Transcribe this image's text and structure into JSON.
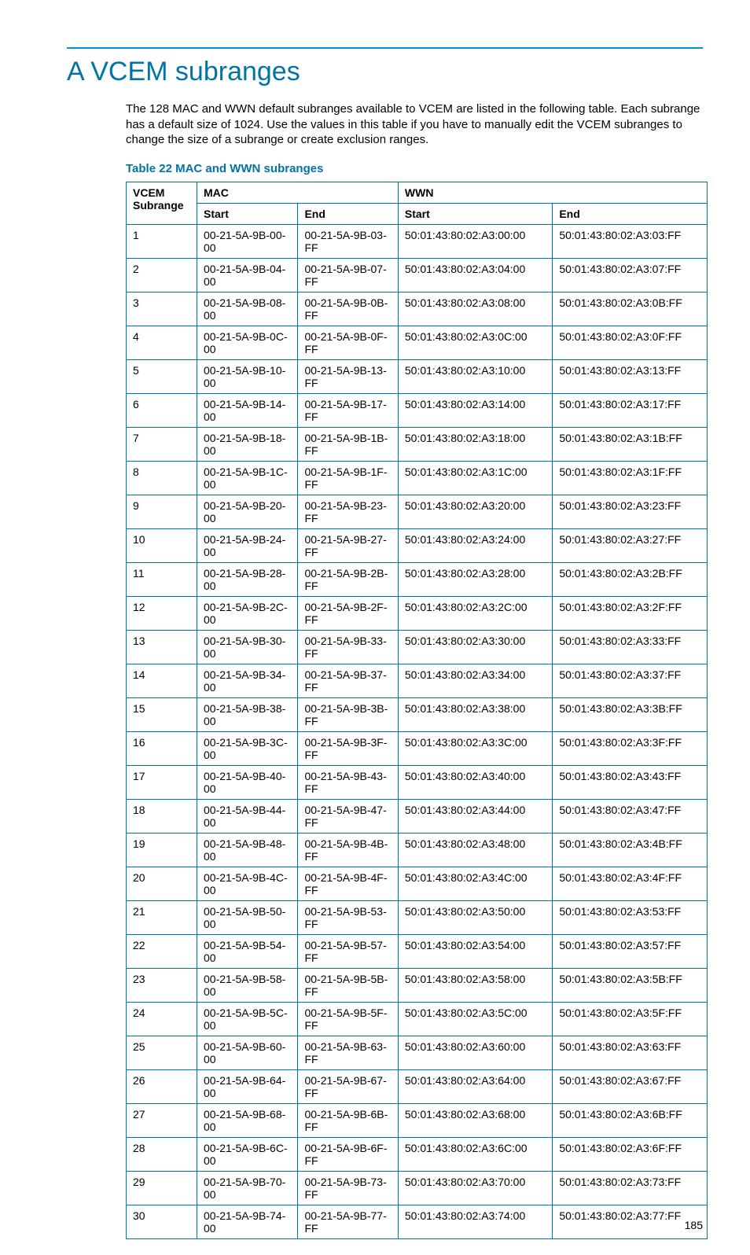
{
  "heading": "A VCEM subranges",
  "intro": "The 128 MAC and WWN default subranges available to VCEM are listed in the following table. Each subrange has a default size of 1024. Use the values in this table if you have to manually edit the VCEM subranges to change the size of a subrange or create exclusion ranges.",
  "table_caption": "Table 22 MAC and WWN subranges",
  "headers": {
    "subrange": "VCEM Subrange",
    "mac": "MAC",
    "wwn": "WWN",
    "start": "Start",
    "end": "End"
  },
  "rows": [
    {
      "n": "1",
      "ms": "00-21-5A-9B-00-00",
      "me": "00-21-5A-9B-03-FF",
      "ws": "50:01:43:80:02:A3:00:00",
      "we": "50:01:43:80:02:A3:03:FF"
    },
    {
      "n": "2",
      "ms": "00-21-5A-9B-04-00",
      "me": "00-21-5A-9B-07-FF",
      "ws": "50:01:43:80:02:A3:04:00",
      "we": "50:01:43:80:02:A3:07:FF"
    },
    {
      "n": "3",
      "ms": "00-21-5A-9B-08-00",
      "me": "00-21-5A-9B-0B-FF",
      "ws": "50:01:43:80:02:A3:08:00",
      "we": "50:01:43:80:02:A3:0B:FF"
    },
    {
      "n": "4",
      "ms": "00-21-5A-9B-0C-00",
      "me": "00-21-5A-9B-0F-FF",
      "ws": "50:01:43:80:02:A3:0C:00",
      "we": "50:01:43:80:02:A3:0F:FF"
    },
    {
      "n": "5",
      "ms": "00-21-5A-9B-10-00",
      "me": "00-21-5A-9B-13-FF",
      "ws": "50:01:43:80:02:A3:10:00",
      "we": "50:01:43:80:02:A3:13:FF"
    },
    {
      "n": "6",
      "ms": "00-21-5A-9B-14-00",
      "me": "00-21-5A-9B-17-FF",
      "ws": "50:01:43:80:02:A3:14:00",
      "we": "50:01:43:80:02:A3:17:FF"
    },
    {
      "n": "7",
      "ms": "00-21-5A-9B-18-00",
      "me": "00-21-5A-9B-1B-FF",
      "ws": "50:01:43:80:02:A3:18:00",
      "we": "50:01:43:80:02:A3:1B:FF"
    },
    {
      "n": "8",
      "ms": "00-21-5A-9B-1C-00",
      "me": "00-21-5A-9B-1F-FF",
      "ws": "50:01:43:80:02:A3:1C:00",
      "we": "50:01:43:80:02:A3:1F:FF"
    },
    {
      "n": "9",
      "ms": "00-21-5A-9B-20-00",
      "me": "00-21-5A-9B-23-FF",
      "ws": "50:01:43:80:02:A3:20:00",
      "we": "50:01:43:80:02:A3:23:FF"
    },
    {
      "n": "10",
      "ms": "00-21-5A-9B-24-00",
      "me": "00-21-5A-9B-27-FF",
      "ws": "50:01:43:80:02:A3:24:00",
      "we": "50:01:43:80:02:A3:27:FF"
    },
    {
      "n": "11",
      "ms": "00-21-5A-9B-28-00",
      "me": "00-21-5A-9B-2B-FF",
      "ws": "50:01:43:80:02:A3:28:00",
      "we": "50:01:43:80:02:A3:2B:FF"
    },
    {
      "n": "12",
      "ms": "00-21-5A-9B-2C-00",
      "me": "00-21-5A-9B-2F-FF",
      "ws": "50:01:43:80:02:A3:2C:00",
      "we": "50:01:43:80:02:A3:2F:FF"
    },
    {
      "n": "13",
      "ms": "00-21-5A-9B-30-00",
      "me": "00-21-5A-9B-33-FF",
      "ws": "50:01:43:80:02:A3:30:00",
      "we": "50:01:43:80:02:A3:33:FF"
    },
    {
      "n": "14",
      "ms": "00-21-5A-9B-34-00",
      "me": "00-21-5A-9B-37-FF",
      "ws": "50:01:43:80:02:A3:34:00",
      "we": "50:01:43:80:02:A3:37:FF"
    },
    {
      "n": "15",
      "ms": "00-21-5A-9B-38-00",
      "me": "00-21-5A-9B-3B-FF",
      "ws": "50:01:43:80:02:A3:38:00",
      "we": "50:01:43:80:02:A3:3B:FF"
    },
    {
      "n": "16",
      "ms": "00-21-5A-9B-3C-00",
      "me": "00-21-5A-9B-3F-FF",
      "ws": "50:01:43:80:02:A3:3C:00",
      "we": "50:01:43:80:02:A3:3F:FF"
    },
    {
      "n": "17",
      "ms": "00-21-5A-9B-40-00",
      "me": "00-21-5A-9B-43-FF",
      "ws": "50:01:43:80:02:A3:40:00",
      "we": "50:01:43:80:02:A3:43:FF"
    },
    {
      "n": "18",
      "ms": "00-21-5A-9B-44-00",
      "me": "00-21-5A-9B-47-FF",
      "ws": "50:01:43:80:02:A3:44:00",
      "we": "50:01:43:80:02:A3:47:FF"
    },
    {
      "n": "19",
      "ms": "00-21-5A-9B-48-00",
      "me": "00-21-5A-9B-4B-FF",
      "ws": "50:01:43:80:02:A3:48:00",
      "we": "50:01:43:80:02:A3:4B:FF"
    },
    {
      "n": "20",
      "ms": "00-21-5A-9B-4C-00",
      "me": "00-21-5A-9B-4F-FF",
      "ws": "50:01:43:80:02:A3:4C:00",
      "we": "50:01:43:80:02:A3:4F:FF"
    },
    {
      "n": "21",
      "ms": "00-21-5A-9B-50-00",
      "me": "00-21-5A-9B-53-FF",
      "ws": "50:01:43:80:02:A3:50:00",
      "we": "50:01:43:80:02:A3:53:FF"
    },
    {
      "n": "22",
      "ms": "00-21-5A-9B-54-00",
      "me": "00-21-5A-9B-57-FF",
      "ws": "50:01:43:80:02:A3:54:00",
      "we": "50:01:43:80:02:A3:57:FF"
    },
    {
      "n": "23",
      "ms": "00-21-5A-9B-58-00",
      "me": "00-21-5A-9B-5B-FF",
      "ws": "50:01:43:80:02:A3:58:00",
      "we": "50:01:43:80:02:A3:5B:FF"
    },
    {
      "n": "24",
      "ms": "00-21-5A-9B-5C-00",
      "me": "00-21-5A-9B-5F-FF",
      "ws": "50:01:43:80:02:A3:5C:00",
      "we": "50:01:43:80:02:A3:5F:FF"
    },
    {
      "n": "25",
      "ms": "00-21-5A-9B-60-00",
      "me": "00-21-5A-9B-63-FF",
      "ws": "50:01:43:80:02:A3:60:00",
      "we": "50:01:43:80:02:A3:63:FF"
    },
    {
      "n": "26",
      "ms": "00-21-5A-9B-64-00",
      "me": "00-21-5A-9B-67-FF",
      "ws": "50:01:43:80:02:A3:64:00",
      "we": "50:01:43:80:02:A3:67:FF"
    },
    {
      "n": "27",
      "ms": "00-21-5A-9B-68-00",
      "me": "00-21-5A-9B-6B-FF",
      "ws": "50:01:43:80:02:A3:68:00",
      "we": "50:01:43:80:02:A3:6B:FF"
    },
    {
      "n": "28",
      "ms": "00-21-5A-9B-6C-00",
      "me": "00-21-5A-9B-6F-FF",
      "ws": "50:01:43:80:02:A3:6C:00",
      "we": "50:01:43:80:02:A3:6F:FF"
    },
    {
      "n": "29",
      "ms": "00-21-5A-9B-70-00",
      "me": "00-21-5A-9B-73-FF",
      "ws": "50:01:43:80:02:A3:70:00",
      "we": "50:01:43:80:02:A3:73:FF"
    },
    {
      "n": "30",
      "ms": "00-21-5A-9B-74-00",
      "me": "00-21-5A-9B-77-FF",
      "ws": "50:01:43:80:02:A3:74:00",
      "we": "50:01:43:80:02:A3:77:FF"
    }
  ],
  "page_number": "185"
}
